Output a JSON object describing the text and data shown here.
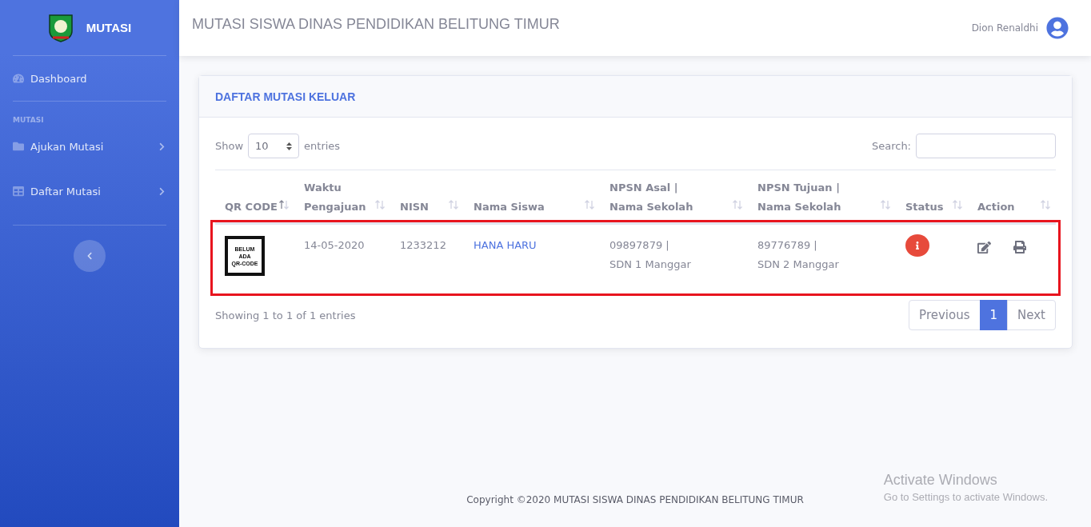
{
  "sidebar": {
    "brand": "MUTASI",
    "items": [
      {
        "kind": "link",
        "label": "Dashboard"
      },
      {
        "kind": "heading",
        "label": "MUTASI"
      },
      {
        "kind": "menu",
        "label": "Ajukan Mutasi"
      },
      {
        "kind": "menu",
        "label": "Daftar Mutasi"
      }
    ]
  },
  "topbar": {
    "title": "MUTASI SISWA DINAS PENDIDIKAN BELITUNG TIMUR",
    "user": "Dion Renaldhi"
  },
  "card": {
    "title": "DAFTAR MUTASI KELUAR",
    "show_label": "Show",
    "page_size": "10",
    "entries_label": "entries",
    "search_label": "Search:",
    "columns": [
      {
        "label": "QR CODE",
        "sorted": true
      },
      {
        "label": "Waktu Pengajuan",
        "sorted": false
      },
      {
        "label": "NISN",
        "sorted": false
      },
      {
        "label": "Nama Siswa",
        "sorted": false
      },
      {
        "label": "NPSN Asal | Nama Sekolah",
        "sorted": false
      },
      {
        "label": "NPSN Tujuan | Nama Sekolah",
        "sorted": false
      },
      {
        "label": "Status",
        "sorted": false
      },
      {
        "label": "Action",
        "sorted": false
      }
    ],
    "rows": [
      {
        "qr_text": [
          "BELUM",
          "ADA",
          "QR-CODE"
        ],
        "waktu": "14-05-2020",
        "nisn": "1233212",
        "nama": "HANA HARU",
        "asal": [
          "09897879 |",
          "SDN 1 Manggar"
        ],
        "tujuan": [
          "89776789 |",
          "SDN 2 Manggar"
        ],
        "status": {
          "color": "#e74a3b"
        }
      }
    ],
    "info": "Showing 1 to 1 of 1 entries",
    "pages": [
      {
        "label": "Previous",
        "selected": false
      },
      {
        "label": "1",
        "selected": true
      },
      {
        "label": "Next",
        "selected": false
      }
    ]
  },
  "footer": "Copyright ©2020 MUTASI SISWA DINAS PENDIDIKAN BELITUNG TIMUR",
  "os_notice": {
    "title": "Activate Windows",
    "text": "Go to Settings to activate Windows."
  }
}
